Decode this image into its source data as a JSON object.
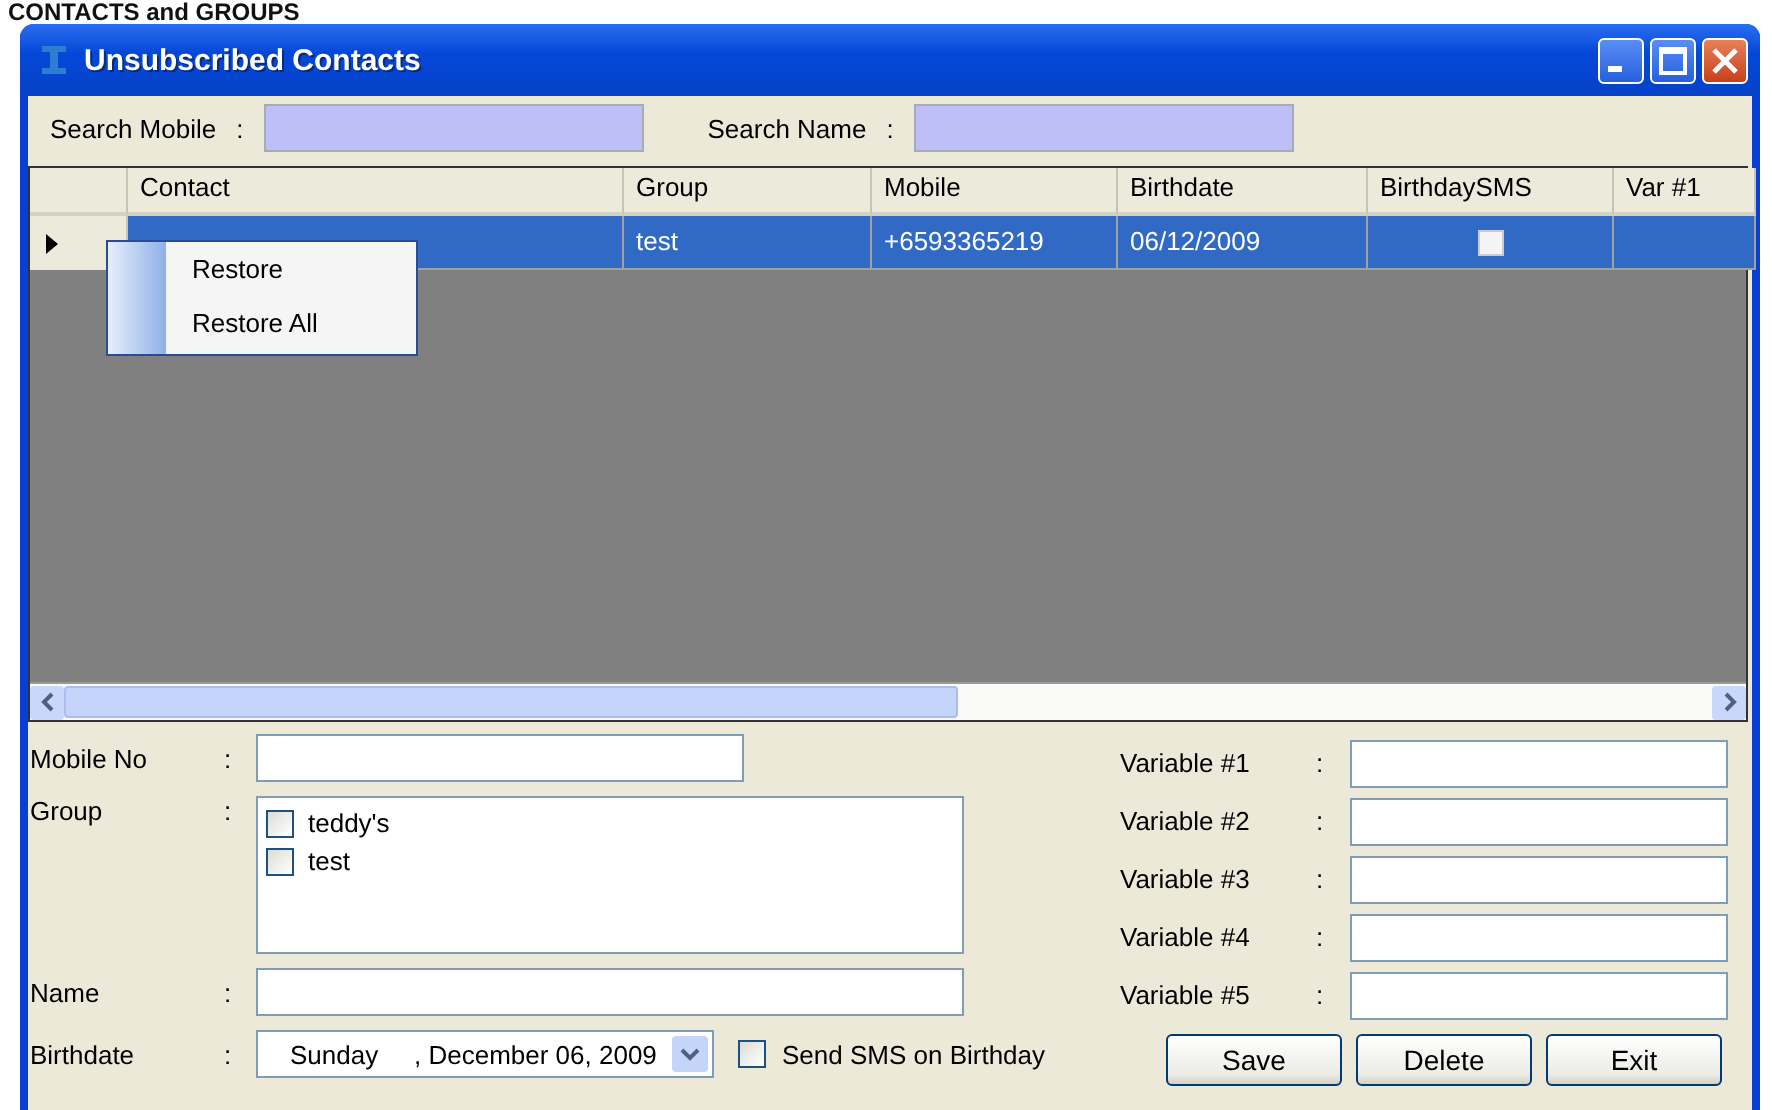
{
  "background": {
    "heading": "CONTACTS and GROUPS"
  },
  "window": {
    "title": "Unsubscribed Contacts"
  },
  "search": [
    {
      "label": "Search Mobile",
      "colon": ":"
    },
    {
      "label": "Search Name",
      "colon": ":"
    }
  ],
  "table": {
    "columns": [
      "Contact",
      "Group",
      "Mobile",
      "Birthdate",
      "BirthdaySMS",
      "Var #1"
    ],
    "rows": [
      {
        "selected": true,
        "current": true,
        "cells": [
          "",
          "test",
          "+6593365219",
          "06/12/2009"
        ],
        "birthday_sms": false
      }
    ]
  },
  "context_menu": {
    "items": [
      "Restore",
      "Restore All"
    ]
  },
  "form": {
    "mobile": {
      "label": "Mobile No",
      "colon": ":"
    },
    "group": {
      "label": "Group",
      "colon": ":",
      "options": [
        {
          "label": "teddy's",
          "checked": false
        },
        {
          "label": "test",
          "checked": false
        }
      ]
    },
    "name": {
      "label": "Name",
      "colon": ":"
    },
    "birthdate": {
      "label": "Birthdate",
      "colon": ":",
      "day": "Sunday",
      "date": ", December 06, 2009"
    },
    "send_sms": {
      "label": "Send SMS on Birthday",
      "checked": false
    },
    "variables": [
      {
        "label": "Variable #1",
        "colon": ":"
      },
      {
        "label": "Variable #2",
        "colon": ":"
      },
      {
        "label": "Variable #3",
        "colon": ":"
      },
      {
        "label": "Variable #4",
        "colon": ":"
      },
      {
        "label": "Variable #5",
        "colon": ":"
      }
    ],
    "buttons": [
      "Save",
      "Delete",
      "Exit"
    ]
  }
}
